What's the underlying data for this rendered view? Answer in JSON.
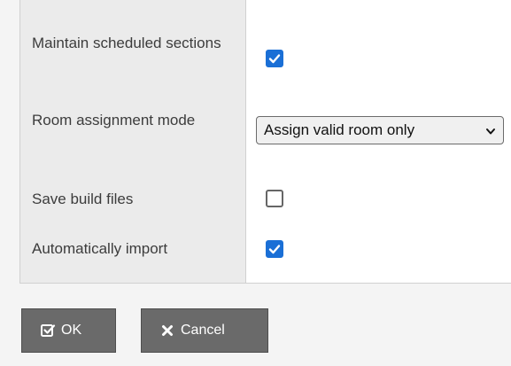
{
  "settings": {
    "rows": [
      {
        "label": "Maintain scheduled sections",
        "checked": true
      },
      {
        "label": "Room assignment mode",
        "value": "Assign valid room only"
      },
      {
        "label": "Save build files",
        "checked": false
      },
      {
        "label": "Automatically import",
        "checked": true
      }
    ]
  },
  "buttons": {
    "ok_label": "OK",
    "cancel_label": "Cancel"
  },
  "colors": {
    "accent": "#1a6fd6",
    "button_bg": "#6a6a6a",
    "label_bg": "#ebebeb"
  },
  "icons": {
    "ok": "checkbox-check-icon",
    "cancel": "x-icon",
    "select": "chevron-down-icon"
  }
}
